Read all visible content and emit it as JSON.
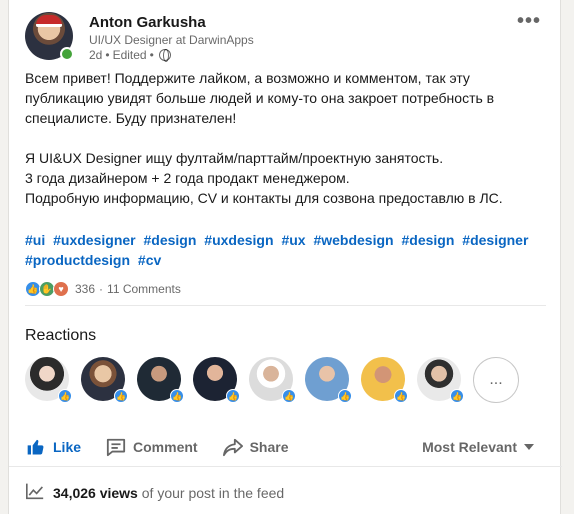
{
  "author": {
    "name": "Anton Garkusha",
    "headline": "UI/UX Designer at DarwinApps",
    "time": "2d",
    "edited": "Edited",
    "dot": "•"
  },
  "post": {
    "lines1": [
      "Всем привет! Поддержите лайком, а возможно и комментом, так эту",
      "публикацию увидят больше людей и кому-то она закроет потребность в",
      "специалисте. Буду признателен!"
    ],
    "lines2": [
      "Я UI&UX Designer ищу фултайм/парттайм/проектную занятость.",
      "3 года дизайнером + 2 года продакт менеджером.",
      "Подробную информацию, CV и контакты для созвона предоставлю в ЛС."
    ],
    "hashtags": [
      "#ui",
      "#uxdesigner",
      "#design",
      "#uxdesign",
      "#ux",
      "#webdesign",
      "#design",
      "#designer",
      "#productdesign",
      "#cv"
    ]
  },
  "social": {
    "reaction_count": "336",
    "separator": "·",
    "comments": "11 Comments"
  },
  "reactions_section": {
    "title": "Reactions",
    "more_label": "..."
  },
  "actions": {
    "like": "Like",
    "comment": "Comment",
    "share": "Share",
    "sort": "Most Relevant"
  },
  "views": {
    "count": "34,026 views",
    "suffix": "of your post in the feed"
  },
  "colors": {
    "link": "#0a66c2",
    "online": "#44a33a",
    "like_badge": "#378fe9"
  }
}
